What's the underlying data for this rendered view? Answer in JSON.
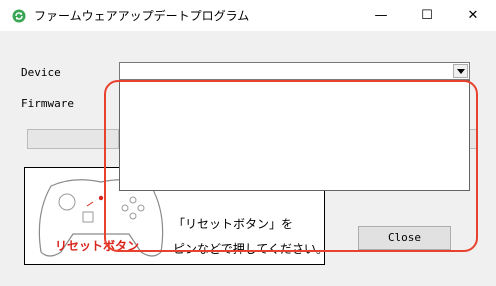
{
  "window": {
    "title": "ファームウェアアップデートプログラム",
    "icon": "refresh-icon",
    "controls": {
      "minimize": "—",
      "maximize": "☐",
      "close": "✕"
    }
  },
  "form": {
    "device_label": "Device",
    "device_value": "",
    "firmware_label": "Firmware"
  },
  "instruction": {
    "reset_button_label": "リセットボタン",
    "line1": "「リセットボタン」を",
    "line2": "ピンなどで押してください。"
  },
  "close_button": "Close",
  "colors": {
    "highlight": "#e8412e",
    "reset_label": "#d8261c"
  }
}
